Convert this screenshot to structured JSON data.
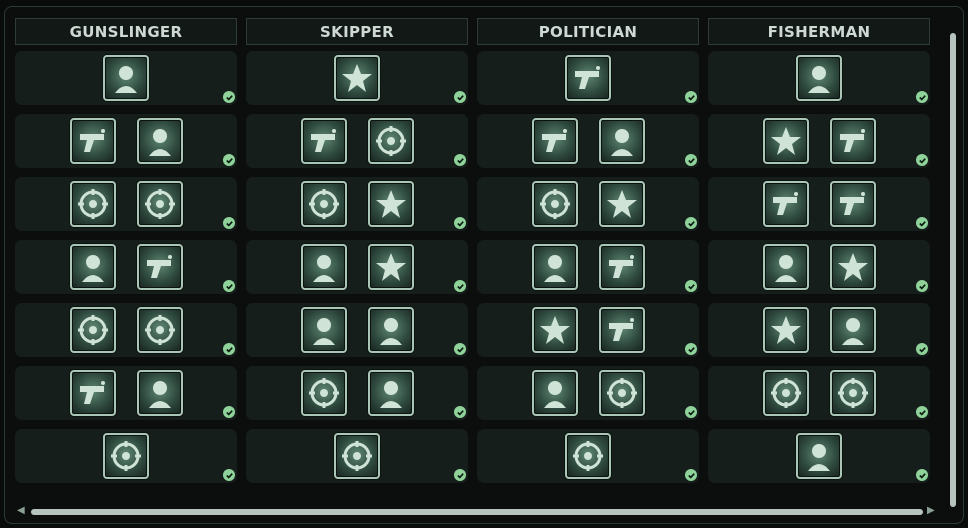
{
  "columns": [
    {
      "title": "GUNSLINGER",
      "rows": [
        [
          "pistols-icon"
        ],
        [
          "laurel-wreath-portrait-icon",
          "saluting-soldier-icon"
        ],
        [
          "cowboy-hat-man-icon",
          "swinging-leg-kick-icon"
        ],
        [
          "revolver-side-icon",
          "revolver-cylinder-icon"
        ],
        [
          "cowboy-hat-icon",
          "wolf-head-icon"
        ],
        [
          "pistol-gun-icon",
          "skull-target-icon"
        ],
        [
          "pistol-sparkle-icon"
        ]
      ]
    },
    {
      "title": "SKIPPER",
      "rows": [
        [
          "ship-wheel-hands-icon"
        ],
        [
          "harmonica-icon",
          "star-medal-icon"
        ],
        [
          "captain-hat-music-icon",
          "splash-wave-icon"
        ],
        [
          "medal-ribbon-icon",
          "ship-helm-icon"
        ],
        [
          "fire-sword-icon",
          "ship-helm-alt-icon"
        ],
        [
          "arm-wrestle-icon",
          "crowd-fists-icon"
        ],
        [
          "sparkle-rifle-icon"
        ]
      ]
    },
    {
      "title": "POLITICIAN",
      "rows": [
        [
          "running-figure-icon"
        ],
        [
          "officer-portrait-icon",
          "hand-truck-icon"
        ],
        [
          "raised-fists-icon",
          "punch-fist-icon"
        ],
        [
          "pushpin-map-icon",
          "waving-flag-icon"
        ],
        [
          "star-emblem-icon",
          "butterfly-icon"
        ],
        [
          "briefcase-money-icon",
          "diamond-bribe-icon"
        ],
        [
          "speaker-bust-icon"
        ]
      ]
    },
    {
      "title": "FISHERMAN",
      "rows": [
        [
          "question-officer-icon"
        ],
        [
          "no-photo-icon",
          "barrel-icon"
        ],
        [
          "praying-hands-icon",
          "muscular-man-icon"
        ],
        [
          "mushroom-cloud-icon",
          "pencil-edit-icon"
        ],
        [
          "skull-gear-icon",
          "diving-head-icon"
        ],
        [
          "skull-hat-icon",
          "fighting-figures-icon"
        ],
        [
          "pickaxe-rock-icon"
        ]
      ]
    }
  ],
  "scroll": {
    "up": "▲",
    "down": "▼",
    "left": "◀",
    "right": "▶"
  },
  "colors": {
    "background": "#0b0e0d",
    "row": "#161e1b",
    "perk_border": "#a9c6b6",
    "check": "#8fd39a"
  }
}
